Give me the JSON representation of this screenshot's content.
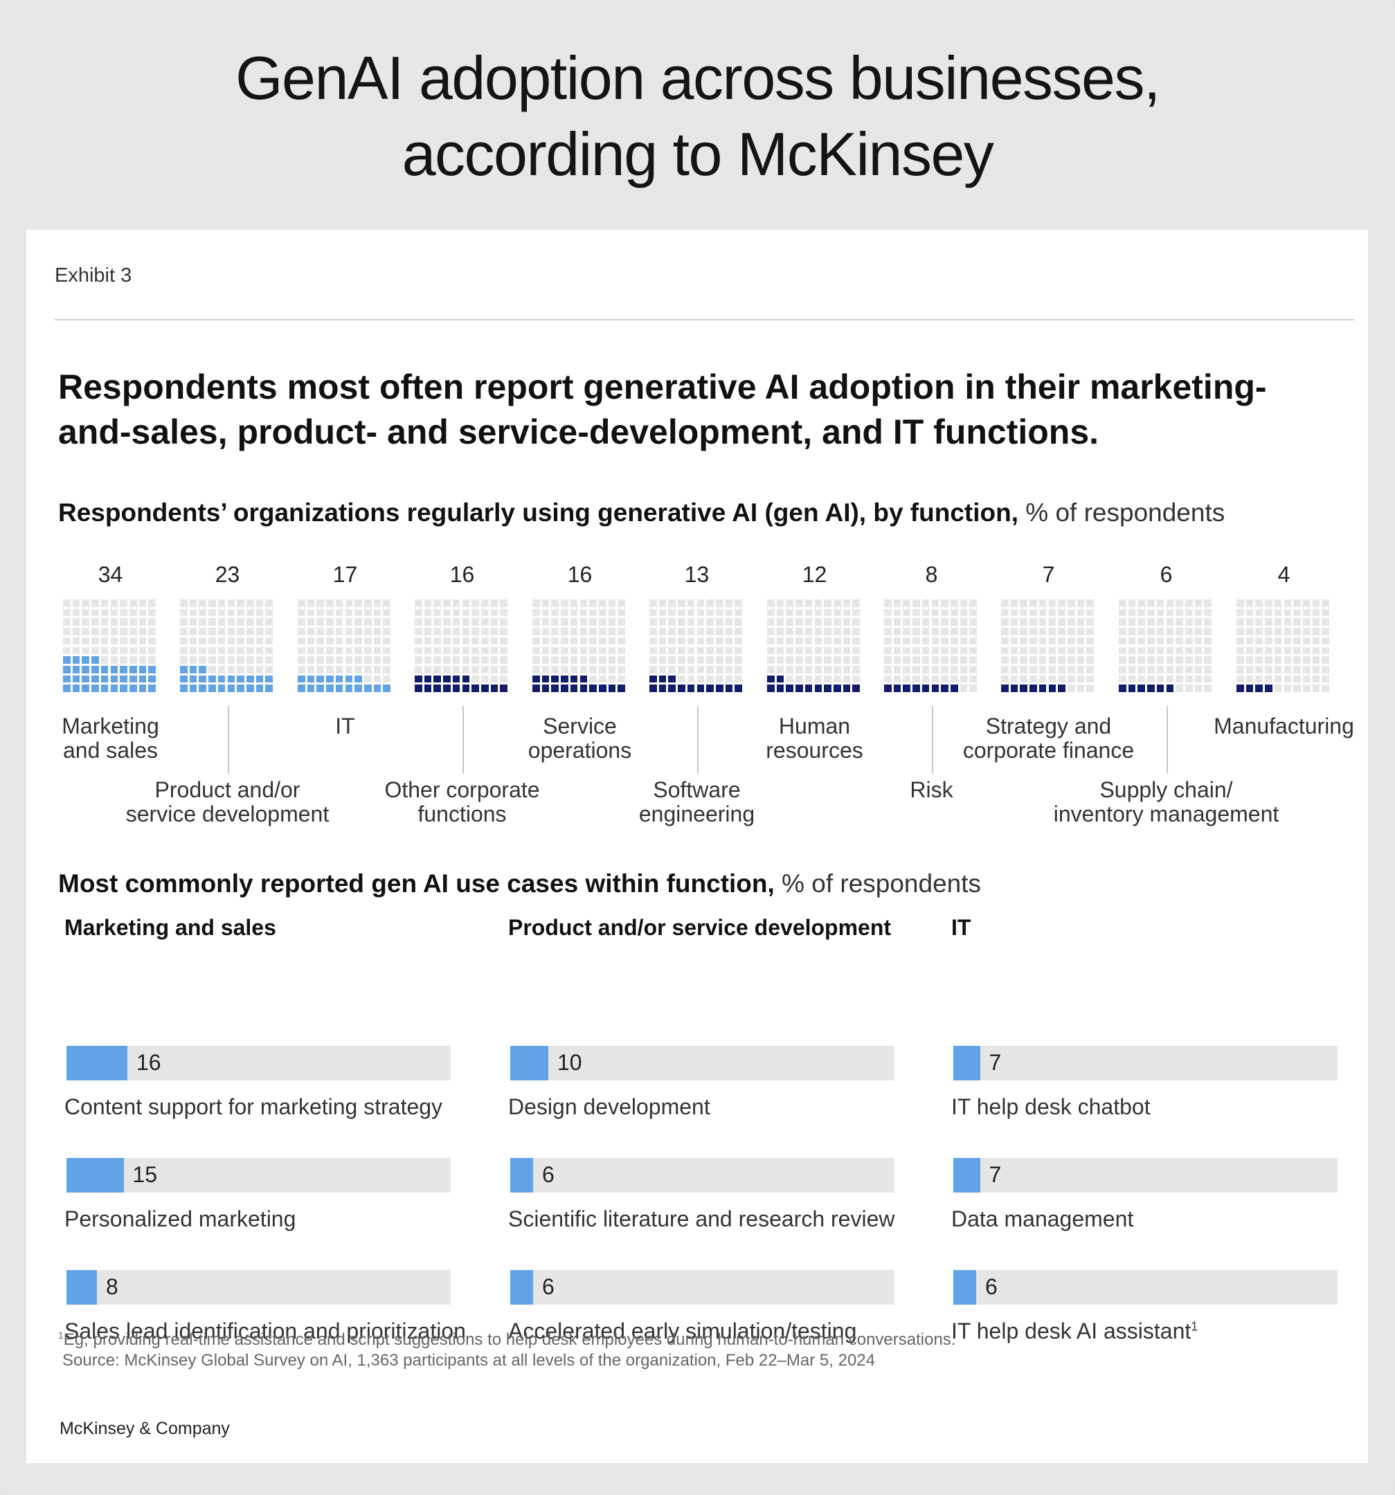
{
  "page_title": "GenAI adoption across businesses, according to McKinsey",
  "page_title_lines": [
    "GenAI adoption across businesses,",
    "according to McKinsey"
  ],
  "exhibit_label": "Exhibit 3",
  "headline": "Respondents most often report generative AI adoption in their marketing-and-sales, product- and service-development, and IT functions.",
  "section1": {
    "title_bold": "Respondents’ organizations regularly using generative AI (gen AI), by function,",
    "title_light": " % of respondents"
  },
  "section2": {
    "title_bold": "Most commonly reported gen AI use cases within function,",
    "title_light": " % of respondents"
  },
  "colors": {
    "highlight": "#62a3e6",
    "other": "#121c6b",
    "empty": "#e6e6e6",
    "bar_fill": "#62a3e6",
    "bar_track": "#e6e6e6"
  },
  "chart_data": [
    {
      "type": "waffle",
      "title": "Respondents’ organizations regularly using generative AI (gen AI), by function, % of respondents",
      "unit": "% of respondents",
      "grid": "10x10",
      "categories": [
        "Marketing and sales",
        "Product and/or service development",
        "IT",
        "Other corporate functions",
        "Service operations",
        "Software engineering",
        "Human resources",
        "Risk",
        "Strategy and corporate finance",
        "Supply chain/ inventory management",
        "Manufacturing"
      ],
      "values": [
        34,
        23,
        17,
        16,
        16,
        13,
        12,
        8,
        7,
        6,
        4
      ],
      "highlighted": [
        true,
        true,
        true,
        false,
        false,
        false,
        false,
        false,
        false,
        false,
        false
      ],
      "labels": [
        [
          "Marketing",
          "and sales"
        ],
        [
          "Product and/or",
          "service development"
        ],
        [
          "IT"
        ],
        [
          "Other corporate",
          "functions"
        ],
        [
          "Service",
          "operations"
        ],
        [
          "Software",
          "engineering"
        ],
        [
          "Human",
          "resources"
        ],
        [
          "Risk"
        ],
        [
          "Strategy and",
          "corporate finance"
        ],
        [
          "Supply chain/",
          "inventory management"
        ],
        [
          "Manufacturing"
        ]
      ]
    },
    {
      "type": "bar",
      "title": "Most commonly reported gen AI use cases within function, % of respondents",
      "xlim": [
        0,
        100
      ],
      "groups": [
        {
          "name": "Marketing and sales",
          "categories": [
            "Content support for marketing strategy",
            "Personalized marketing",
            "Sales lead identification and prioritization"
          ],
          "values": [
            16,
            15,
            8
          ]
        },
        {
          "name": "Product and/or service development",
          "categories": [
            "Design development",
            "Scientific literature and research review",
            "Accelerated early simulation/testing"
          ],
          "values": [
            10,
            6,
            6
          ]
        },
        {
          "name": "IT",
          "categories": [
            "IT help desk chatbot",
            "Data management",
            "IT help desk AI assistant"
          ],
          "values": [
            7,
            7,
            6
          ],
          "footnote_marks": [
            "",
            "",
            "1"
          ]
        }
      ]
    }
  ],
  "footnote": {
    "mark": "1",
    "text": "Eg, providing real-time assistance and script suggestions to help desk employees during human-to-human conversations.",
    "source": "Source: McKinsey Global Survey on AI, 1,363 participants at all levels of the organization, Feb 22–Mar 5, 2024"
  },
  "brand": "McKinsey & Company"
}
